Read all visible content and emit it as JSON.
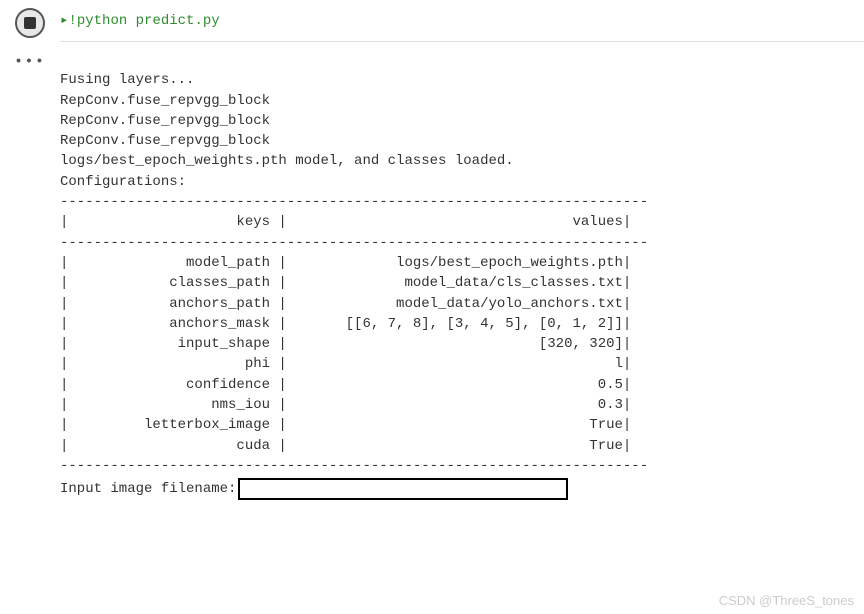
{
  "code": {
    "command": "!python  predict.py"
  },
  "output": {
    "ellipsis": "•••",
    "preamble": [
      "Fusing layers...",
      "RepConv.fuse_repvgg_block",
      "RepConv.fuse_repvgg_block",
      "RepConv.fuse_repvgg_block",
      "logs/best_epoch_weights.pth model, and classes loaded.",
      "Configurations:"
    ],
    "table": {
      "divider": "----------------------------------------------------------------------",
      "header_keys": "keys",
      "header_values": "values",
      "rows": [
        {
          "key": "model_path",
          "value": "logs/best_epoch_weights.pth"
        },
        {
          "key": "classes_path",
          "value": "model_data/cls_classes.txt"
        },
        {
          "key": "anchors_path",
          "value": "model_data/yolo_anchors.txt"
        },
        {
          "key": "anchors_mask",
          "value": "[[6, 7, 8], [3, 4, 5], [0, 1, 2]]"
        },
        {
          "key": "input_shape",
          "value": "[320, 320]"
        },
        {
          "key": "phi",
          "value": "l"
        },
        {
          "key": "confidence",
          "value": "0.5"
        },
        {
          "key": "nms_iou",
          "value": "0.3"
        },
        {
          "key": "letterbox_image",
          "value": "True"
        },
        {
          "key": "cuda",
          "value": "True"
        }
      ]
    },
    "prompt_label": "Input image filename:"
  },
  "watermark": "CSDN @ThreeS_tones"
}
